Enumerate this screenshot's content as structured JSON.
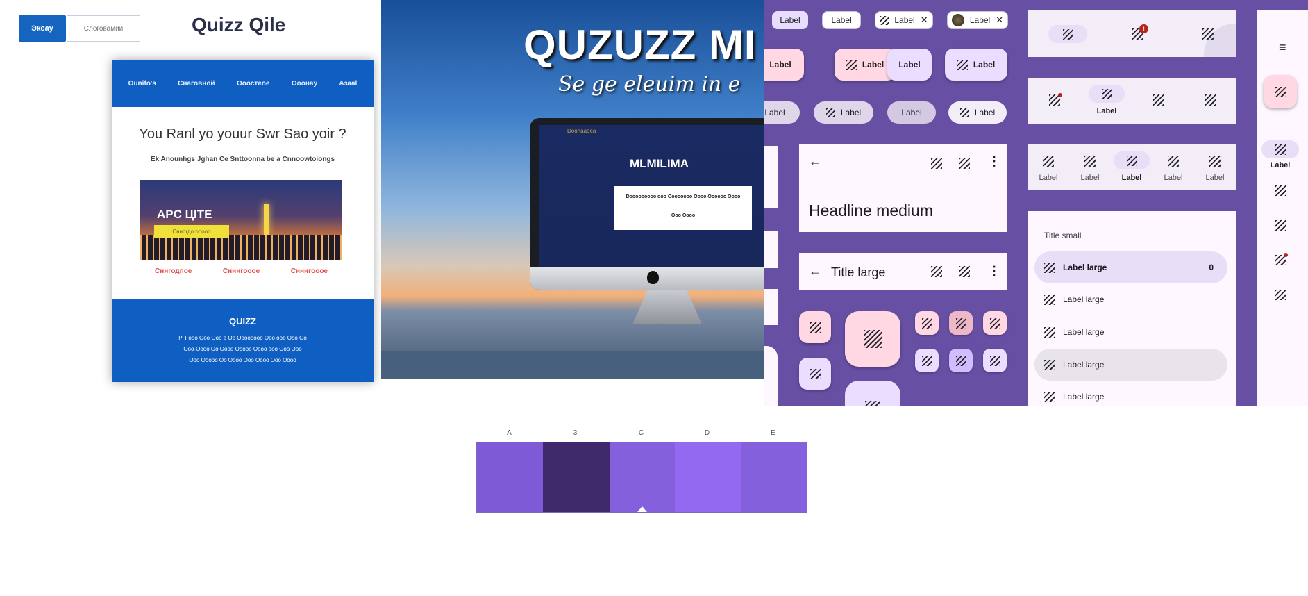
{
  "website_mockup": {
    "tabs": [
      "Эксау",
      "Слоговамии"
    ],
    "logo": "Quizz Qile",
    "nav": [
      "Ounifo's",
      "Снаговной",
      "Ооостеое",
      "Ооонау",
      "Азааl"
    ],
    "hero_title": "You Ranl yo youur Swr Sao yoir ?",
    "hero_sub": "Ek Anounhgs Jghan Ce Snttoonna be a Cnnoowtoiongs",
    "banner_title": "APC ЦITE",
    "banner_cta": "Снногдо ооооо",
    "link_row": [
      "Сннгодпое",
      "Снннгооое",
      "Снннгооое"
    ],
    "footer_title": "QUIZZ",
    "footer_lines": [
      "Pi Fooo Ooo Ooo e Oo Oooooooo Ooo ooo Ooo Oo",
      "Ooo-Oooo Oo Oooo Ooooo Oooo ooo Ooo Ooo",
      "Ooo Ooooo Oo Oooo Ooo Oooo Ooo Oooo"
    ]
  },
  "poster": {
    "title": "QUZUZZ MI",
    "subtitle": "Se ge eleuim in e",
    "screen_brand": "MLMILIMA",
    "screen_topbar": "Doonaaoea",
    "screen_box_line1": "Dooooooooo ooo Oooooooo Oooo Oooooo Oooo",
    "screen_box_line2": "Ooo Oooo"
  },
  "material_kit": {
    "chips_row1": [
      {
        "label": "Label"
      },
      {
        "label": "Label"
      },
      {
        "label": "Label",
        "icon": "hatch-icon",
        "close": true
      },
      {
        "label": "Label",
        "avatar": true,
        "close": true
      }
    ],
    "buttons_row2": [
      "Label",
      "Label",
      "Label",
      "Label"
    ],
    "buttons_row3": [
      "Label",
      "Label",
      "Label",
      "Label"
    ],
    "top_app_bar_medium": {
      "headline": "Headline medium"
    },
    "top_app_bar_small": {
      "title": "Title large"
    },
    "nav_bar_1": {
      "badge": "1"
    },
    "nav_bar_2": {
      "label": "Label"
    },
    "nav_bar_3": {
      "labels": [
        "Label",
        "Label",
        "Label",
        "Label",
        "Label"
      ]
    },
    "nav_drawer": {
      "section": "Title small",
      "items": [
        {
          "label": "Label large",
          "count": "0"
        },
        {
          "label": "Label large"
        },
        {
          "label": "Label large"
        },
        {
          "label": "Label large"
        },
        {
          "label": "Label large"
        }
      ]
    },
    "nav_rail": {
      "label": "Label"
    }
  },
  "palette": {
    "labels": [
      "A",
      "3",
      "C",
      "D",
      "E"
    ],
    "colors": [
      "#7f5ad6",
      "#3f2a6b",
      "#8560dc",
      "#9469f1",
      "#8560dc"
    ],
    "note": "·"
  }
}
